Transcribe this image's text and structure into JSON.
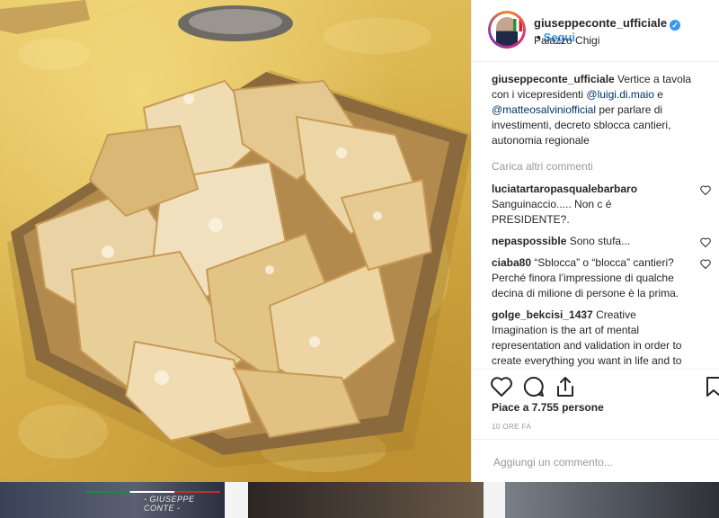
{
  "post": {
    "username": "giuseppeconte_ufficiale",
    "verified_mark": "✓",
    "separator": "•",
    "follow_label": "Segui",
    "location": "Palazzo Chigi",
    "caption": {
      "username": "giuseppeconte_ufficiale",
      "text_before": " Vertice a tavola con i vicepresidenti ",
      "mention1": "@luigi.di.maio",
      "text_mid": " e ",
      "mention2": "@matteosalviniofficial",
      "text_after": " per parlare di investimenti, decreto sblocca cantieri, autonomia regionale"
    },
    "load_more": "Carica altri commenti",
    "comments": [
      {
        "user": "luciatartaropasqualebarbaro",
        "text": "Sanguinaccio..... Non c é PRESIDENTE?."
      },
      {
        "user": "nepaspossible",
        "text": "Sono stufa..."
      },
      {
        "user": "ciaba80",
        "text": "“Sblocca” o “blocca” cantieri? Perché finora l’impressione di qualche decina di milione di persone è la prima."
      },
      {
        "user": "golge_bekcisi_1437",
        "text": "Creative Imagination is the art of mental representation and validation in order to create everything you want in life and to change your life in a positive way. Today, health, education, work"
      }
    ],
    "likes": "Piace a 7.755 persone",
    "time": "10 ORE FA",
    "comment_placeholder": "Aggiungi un commento..."
  },
  "icons": {
    "like": "heart-icon",
    "comment": "comment-icon",
    "share": "share-icon",
    "save": "bookmark-icon"
  },
  "strip": {
    "tv_label": "- GIUSEPPE CONTE -"
  }
}
